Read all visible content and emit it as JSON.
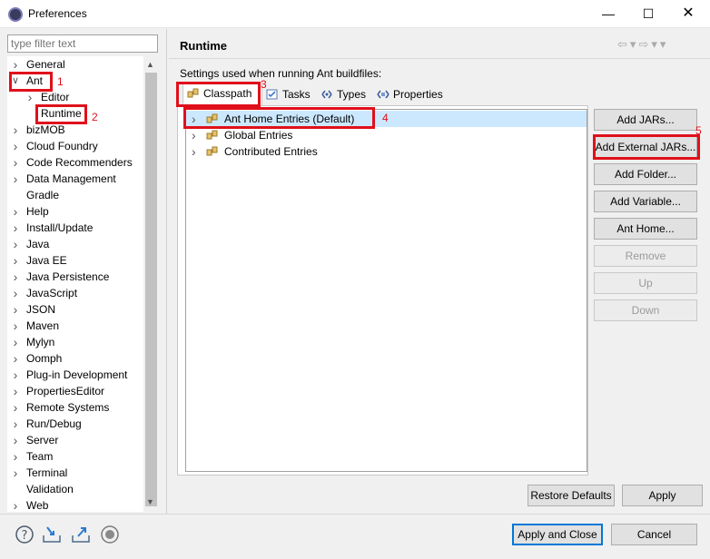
{
  "window": {
    "title": "Preferences",
    "min_icon": "minimize-icon",
    "max_icon": "maximize-icon",
    "close_icon": "close-icon"
  },
  "filter": {
    "placeholder": "type filter text"
  },
  "tree": {
    "items": [
      {
        "label": "General",
        "expander": "collapsed"
      },
      {
        "label": "Ant",
        "expander": "expanded"
      },
      {
        "label": "Editor",
        "expander": "collapsed",
        "indent": 1
      },
      {
        "label": "Runtime",
        "expander": "none",
        "indent": 1,
        "selected": true
      },
      {
        "label": "bizMOB",
        "expander": "collapsed"
      },
      {
        "label": "Cloud Foundry",
        "expander": "collapsed"
      },
      {
        "label": "Code Recommenders",
        "expander": "collapsed"
      },
      {
        "label": "Data Management",
        "expander": "collapsed"
      },
      {
        "label": "Gradle",
        "expander": "none"
      },
      {
        "label": "Help",
        "expander": "collapsed"
      },
      {
        "label": "Install/Update",
        "expander": "collapsed"
      },
      {
        "label": "Java",
        "expander": "collapsed"
      },
      {
        "label": "Java EE",
        "expander": "collapsed"
      },
      {
        "label": "Java Persistence",
        "expander": "collapsed"
      },
      {
        "label": "JavaScript",
        "expander": "collapsed"
      },
      {
        "label": "JSON",
        "expander": "collapsed"
      },
      {
        "label": "Maven",
        "expander": "collapsed"
      },
      {
        "label": "Mylyn",
        "expander": "collapsed"
      },
      {
        "label": "Oomph",
        "expander": "collapsed"
      },
      {
        "label": "Plug-in Development",
        "expander": "collapsed"
      },
      {
        "label": "PropertiesEditor",
        "expander": "collapsed"
      },
      {
        "label": "Remote Systems",
        "expander": "collapsed"
      },
      {
        "label": "Run/Debug",
        "expander": "collapsed"
      },
      {
        "label": "Server",
        "expander": "collapsed"
      },
      {
        "label": "Team",
        "expander": "collapsed"
      },
      {
        "label": "Terminal",
        "expander": "collapsed"
      },
      {
        "label": "Validation",
        "expander": "none"
      },
      {
        "label": "Web",
        "expander": "collapsed"
      }
    ]
  },
  "page": {
    "title": "Runtime",
    "description": "Settings used when running Ant buildfiles:",
    "nav_icons": [
      "back-icon",
      "back-menu-icon",
      "forward-icon",
      "forward-menu-icon",
      "view-menu-icon"
    ]
  },
  "tabs": [
    {
      "label": "Classpath",
      "icon": "classpath-icon",
      "active": true
    },
    {
      "label": "Tasks",
      "icon": "tasks-icon"
    },
    {
      "label": "Types",
      "icon": "types-icon"
    },
    {
      "label": "Properties",
      "icon": "properties-icon"
    }
  ],
  "classpath": {
    "entries": [
      {
        "label": "Ant Home Entries (Default)",
        "selected": true
      },
      {
        "label": "Global Entries"
      },
      {
        "label": "Contributed Entries"
      }
    ]
  },
  "side_buttons": [
    {
      "label": "Add JARs...",
      "enabled": true
    },
    {
      "label": "Add External JARs...",
      "enabled": true
    },
    {
      "label": "Add Folder...",
      "enabled": true
    },
    {
      "label": "Add Variable...",
      "enabled": true
    },
    {
      "label": "Ant Home...",
      "enabled": true
    },
    {
      "label": "Remove",
      "enabled": false
    },
    {
      "label": "Up",
      "enabled": false
    },
    {
      "label": "Down",
      "enabled": false
    }
  ],
  "page_buttons": {
    "restore": "Restore Defaults",
    "apply": "Apply"
  },
  "dialog_buttons": {
    "apply_close": "Apply and Close",
    "cancel": "Cancel"
  },
  "bottom_icons": [
    "help-icon",
    "import-icon",
    "export-icon",
    "record-icon"
  ],
  "annotations": [
    "1",
    "2",
    "3",
    "4",
    "5"
  ],
  "annotation_color": "#e0101a",
  "selection_color": "#cce8ff"
}
